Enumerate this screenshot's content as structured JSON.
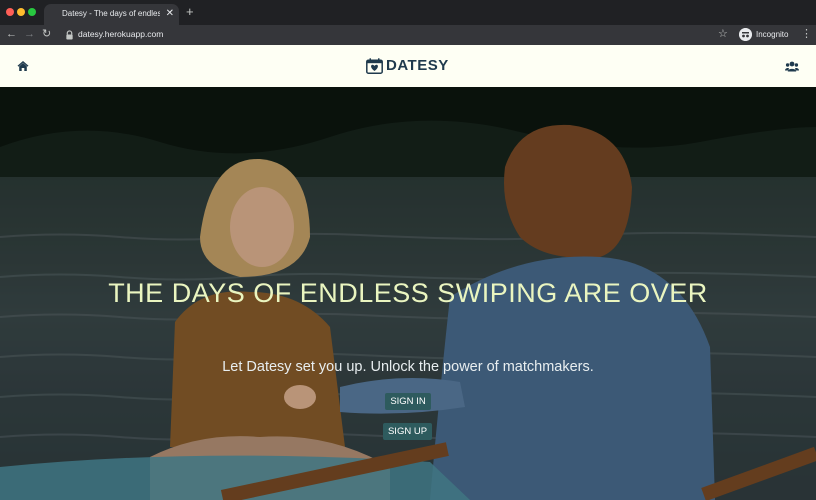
{
  "browser": {
    "tab_title": "Datesy - The days of endless s",
    "tab_close": "✕",
    "new_tab": "+",
    "url": "datesy.herokuapp.com",
    "incognito_label": "Incognito"
  },
  "header": {
    "brand": "DATESY"
  },
  "hero": {
    "title": "THE DAYS OF ENDLESS SWIPING ARE OVER",
    "subtitle": "Let Datesy set you up. Unlock the power of matchmakers.",
    "signin_label": "SIGN IN",
    "signup_label": "SIGN UP"
  },
  "colors": {
    "header_bg": "#fefff4",
    "brand": "#1f3a4d",
    "hero_title": "#eaf5c0",
    "button_bg": "#2e5b5e"
  },
  "icons": [
    "home-icon",
    "calendar-heart-icon",
    "users-icon",
    "lock-icon",
    "star-icon",
    "incognito-icon",
    "menu-icon"
  ]
}
